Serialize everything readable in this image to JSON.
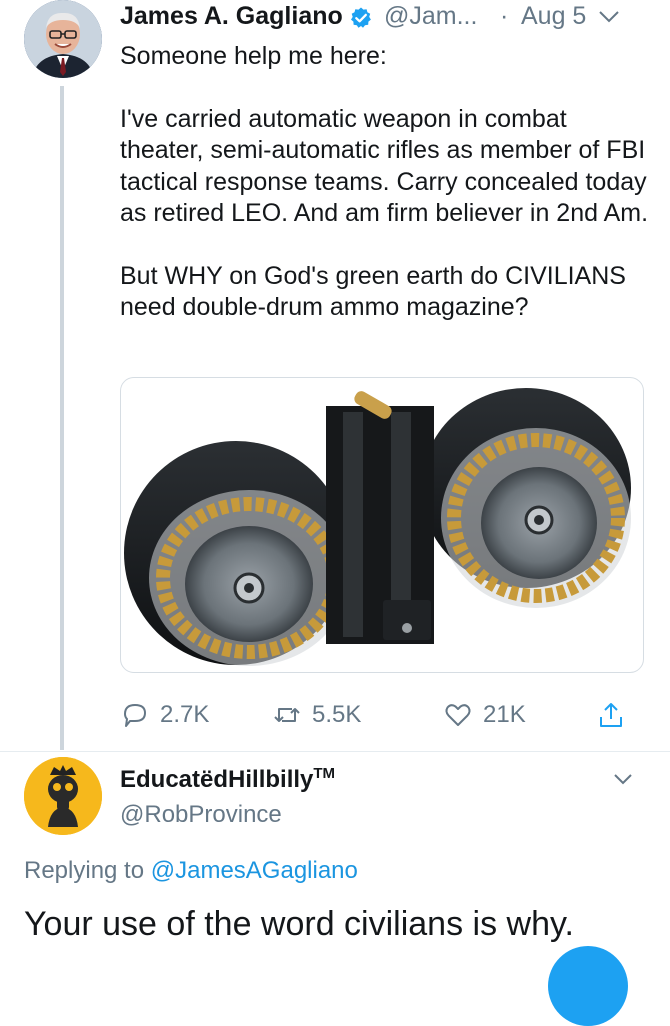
{
  "tweet": {
    "author_name": "James A. Gagliano",
    "author_handle": "@Jam...",
    "separator": "·",
    "date": "Aug 5",
    "text_paragraphs": [
      "Someone help me here:",
      "I've carried automatic weapon in combat theater, semi-automatic rifles as member of FBI tactical response teams. Carry concealed today as retired LEO. And am firm believer in 2nd Am.",
      "But WHY on God's green earth do CIVILIANS need double-drum ammo magazine?"
    ],
    "actions": {
      "replies": "2.7K",
      "retweets": "5.5K",
      "likes": "21K"
    }
  },
  "reply": {
    "author_name": "EducatëdHillbilly",
    "trademark": "TM",
    "author_handle": "@RobProvince",
    "replying_prefix": "Replying to",
    "replying_to": "@JamesAGagliano",
    "text": "Your use of the word civilians is why."
  },
  "colors": {
    "text": "#14171a",
    "secondary": "#657786",
    "link": "#1b95e0",
    "verified": "#1da1f2",
    "avatar2_bg": "#f6b81c"
  },
  "icons": [
    "verified-badge-icon",
    "chevron-down-icon",
    "reply-icon",
    "retweet-icon",
    "like-icon",
    "share-icon"
  ]
}
